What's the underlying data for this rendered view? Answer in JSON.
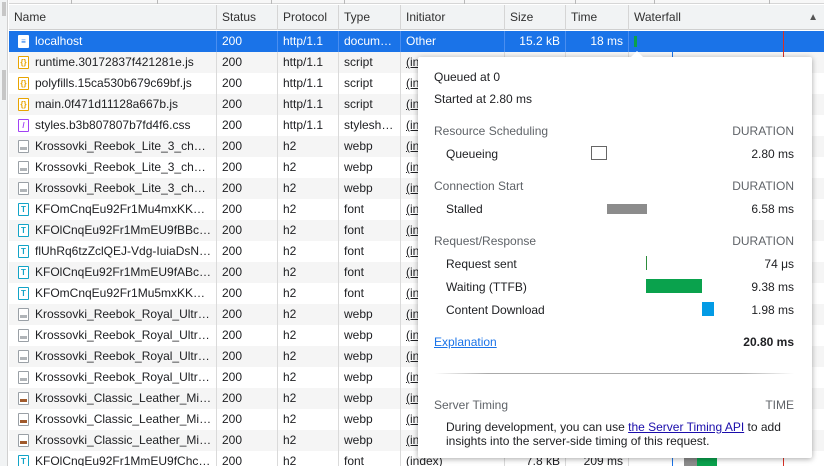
{
  "columns": {
    "name": "Name",
    "status": "Status",
    "protocol": "Protocol",
    "type": "Type",
    "initiator": "Initiator",
    "size": "Size",
    "time": "Time",
    "waterfall": "Waterfall",
    "sort_indicator": "▲"
  },
  "rows": [
    {
      "name": "localhost",
      "status": "200",
      "protocol": "http/1.1",
      "type": "docum…",
      "initiator": "Other",
      "size": "15.2 kB",
      "time": "18 ms",
      "icon": "document-icon"
    },
    {
      "name": "runtime.30172837f421281e.js",
      "status": "200",
      "protocol": "http/1.1",
      "type": "script",
      "initiator": "(in",
      "icon": "script-icon"
    },
    {
      "name": "polyfills.15ca530b679c69bf.js",
      "status": "200",
      "protocol": "http/1.1",
      "type": "script",
      "initiator": "(in",
      "icon": "script-icon"
    },
    {
      "name": "main.0f471d11128a667b.js",
      "status": "200",
      "protocol": "http/1.1",
      "type": "script",
      "initiator": "(in",
      "icon": "script-icon"
    },
    {
      "name": "styles.b3b807807b7fd4f6.css",
      "status": "200",
      "protocol": "http/1.1",
      "type": "stylesh…",
      "initiator": "(in",
      "icon": "stylesheet-icon"
    },
    {
      "name": "Krossovki_Reebok_Lite_3_ch…",
      "status": "200",
      "protocol": "h2",
      "type": "webp",
      "initiator": "(in",
      "icon": "image-icon"
    },
    {
      "name": "Krossovki_Reebok_Lite_3_ch…",
      "status": "200",
      "protocol": "h2",
      "type": "webp",
      "initiator": "(in",
      "icon": "image-icon"
    },
    {
      "name": "Krossovki_Reebok_Lite_3_ch…",
      "status": "200",
      "protocol": "h2",
      "type": "webp",
      "initiator": "(in",
      "icon": "image-icon"
    },
    {
      "name": "KFOmCnqEu92Fr1Mu4mxKK…",
      "status": "200",
      "protocol": "h2",
      "type": "font",
      "initiator": "(in",
      "icon": "font-icon"
    },
    {
      "name": "KFOlCnqEu92Fr1MmEU9fBBc…",
      "status": "200",
      "protocol": "h2",
      "type": "font",
      "initiator": "(in",
      "icon": "font-icon"
    },
    {
      "name": "flUhRq6tzZclQEJ-Vdg-IuiaDsN…",
      "status": "200",
      "protocol": "h2",
      "type": "font",
      "initiator": "(in",
      "icon": "font-icon"
    },
    {
      "name": "KFOlCnqEu92Fr1MmEU9fABc…",
      "status": "200",
      "protocol": "h2",
      "type": "font",
      "initiator": "(in",
      "icon": "font-icon"
    },
    {
      "name": "KFOmCnqEu92Fr1Mu5mxKK…",
      "status": "200",
      "protocol": "h2",
      "type": "font",
      "initiator": "(in",
      "icon": "font-icon"
    },
    {
      "name": "Krossovki_Reebok_Royal_Ultr…",
      "status": "200",
      "protocol": "h2",
      "type": "webp",
      "initiator": "(in",
      "icon": "image-icon"
    },
    {
      "name": "Krossovki_Reebok_Royal_Ultr…",
      "status": "200",
      "protocol": "h2",
      "type": "webp",
      "initiator": "(in",
      "icon": "image-icon"
    },
    {
      "name": "Krossovki_Reebok_Royal_Ultr…",
      "status": "200",
      "protocol": "h2",
      "type": "webp",
      "initiator": "(in",
      "icon": "image-icon"
    },
    {
      "name": "Krossovki_Reebok_Royal_Ultr…",
      "status": "200",
      "protocol": "h2",
      "type": "webp",
      "initiator": "(in",
      "icon": "image-icon"
    },
    {
      "name": "Krossovki_Classic_Leather_Mi…",
      "status": "200",
      "protocol": "h2",
      "type": "webp",
      "initiator": "(in",
      "icon": "image-icon-brown"
    },
    {
      "name": "Krossovki_Classic_Leather_Mi…",
      "status": "200",
      "protocol": "h2",
      "type": "webp",
      "initiator": "(in",
      "icon": "image-icon-brown"
    },
    {
      "name": "Krossovki_Classic_Leather_Mi…",
      "status": "200",
      "protocol": "h2",
      "type": "webp",
      "initiator": "(in",
      "icon": "image-icon-brown"
    },
    {
      "name": "KFOlCnqEu92Fr1MmEU9fChc…",
      "status": "200",
      "protocol": "h2",
      "type": "font",
      "initiator": "(index)",
      "size": "7.8 kB",
      "time": "209 ms",
      "icon": "font-icon"
    }
  ],
  "timing": {
    "queued": "Queued at 0",
    "started": "Started at 2.80 ms",
    "duration_label": "DURATION",
    "resource_scheduling": {
      "title": "Resource Scheduling",
      "queueing_label": "Queueing",
      "queueing_value": "2.80 ms"
    },
    "connection_start": {
      "title": "Connection Start",
      "stalled_label": "Stalled",
      "stalled_value": "6.58 ms"
    },
    "request_response": {
      "title": "Request/Response",
      "request_sent_label": "Request sent",
      "request_sent_value": "74 μs",
      "waiting_label": "Waiting (TTFB)",
      "waiting_value": "9.38 ms",
      "download_label": "Content Download",
      "download_value": "1.98 ms"
    },
    "explanation": "Explanation",
    "total": "20.80 ms",
    "server_timing": {
      "title": "Server Timing",
      "time_label": "TIME",
      "text_before": "During development, you can use ",
      "link": "the Server Timing API",
      "text_after": " to add",
      "text_line2": "insights into the server-side timing of this request."
    }
  },
  "colors": {
    "selected_row": "#1a73e8",
    "queueing": "#ffffff",
    "stalled": "#8c8c8c",
    "request_sent": "#2d8c3c",
    "waiting": "#0aa24d",
    "download": "#039be5",
    "waterfall_red_line": "#d93025",
    "waterfall_blue_line": "#1a73e8"
  }
}
